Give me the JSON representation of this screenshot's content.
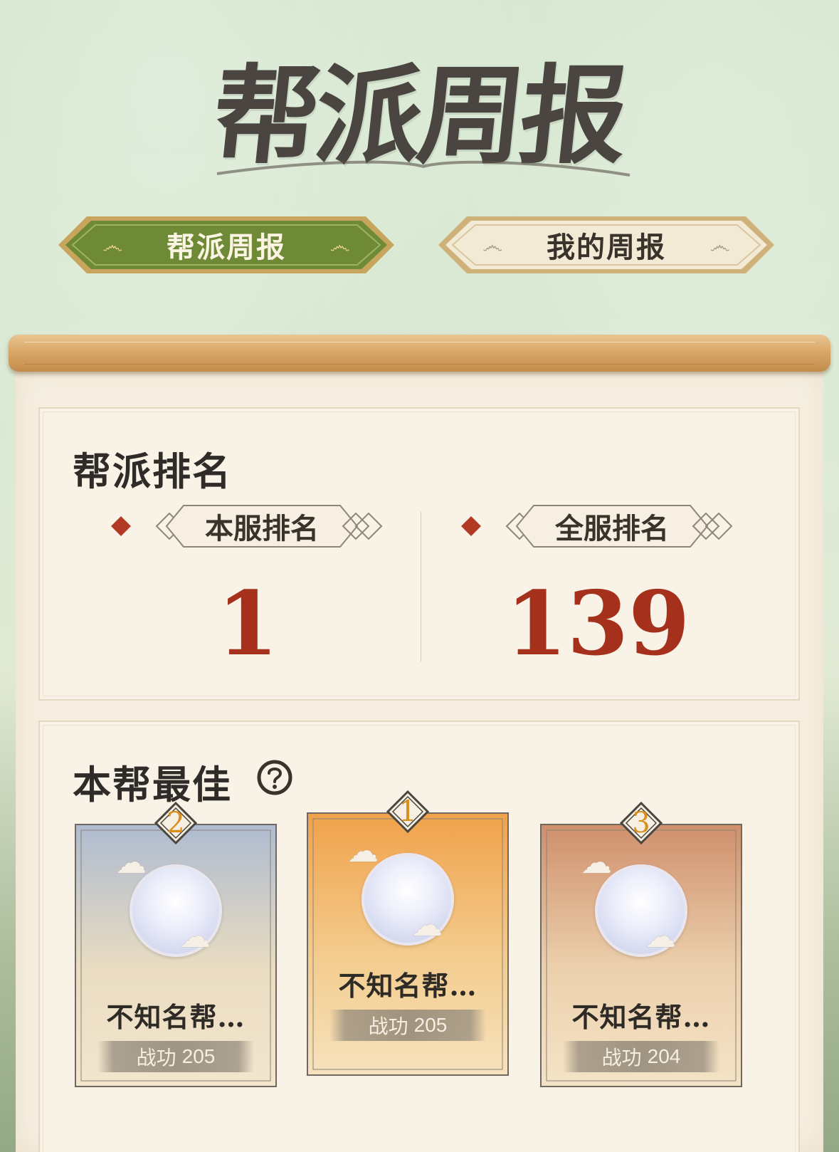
{
  "header": {
    "title": "帮派周报"
  },
  "tabs": [
    {
      "label": "帮派周报",
      "active": true
    },
    {
      "label": "我的周报",
      "active": false
    }
  ],
  "ranking": {
    "title": "帮派排名",
    "local": {
      "label": "本服排名",
      "value": "1"
    },
    "global": {
      "label": "全服排名",
      "value": "139"
    }
  },
  "best": {
    "title": "本帮最佳",
    "help_icon": "question-icon",
    "cards": [
      {
        "rank": "2",
        "name": "不知名帮…",
        "score_label": "战功",
        "score": "205"
      },
      {
        "rank": "1",
        "name": "不知名帮…",
        "score_label": "战功",
        "score": "205"
      },
      {
        "rank": "3",
        "name": "不知名帮…",
        "score_label": "战功",
        "score": "204"
      }
    ]
  },
  "colors": {
    "accent_red": "#a5311d",
    "tab_active": "#6e8a36",
    "tab_inactive": "#f3ead6",
    "badge_gold": "#d98e1d",
    "card_top": "#f0a14a",
    "card_second": "#aebbd0",
    "card_third": "#cf8f6c"
  }
}
